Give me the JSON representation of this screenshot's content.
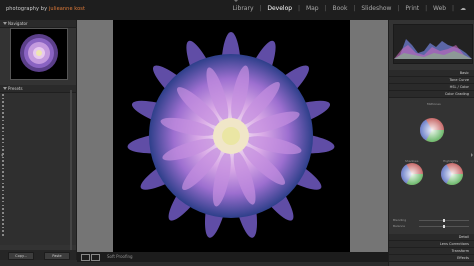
{
  "identity": {
    "prefix": "photography by ",
    "name": "julieanne kost"
  },
  "modules": [
    {
      "label": "Library",
      "active": false
    },
    {
      "label": "Develop",
      "active": true
    },
    {
      "label": "Map",
      "active": false
    },
    {
      "label": "Book",
      "active": false
    },
    {
      "label": "Slideshow",
      "active": false
    },
    {
      "label": "Print",
      "active": false
    },
    {
      "label": "Web",
      "active": false
    }
  ],
  "left_panel": {
    "navigator_title": "Navigator",
    "presets_title": "Presets",
    "copy_label": "Copy...",
    "paste_label": "Paste"
  },
  "filmstrip_toolbar": {
    "softproof_label": "Soft Proofing"
  },
  "right_panel": {
    "basic": "Basic",
    "tone_curve": "Tone Curve",
    "hsl": "HSL / Color",
    "color_grading": "Color Grading",
    "midtones": "Midtones",
    "shadows": "Shadows",
    "highlights": "Highlights",
    "blending": "Blending",
    "balance": "Balance",
    "detail": "Detail",
    "lens": "Lens Corrections",
    "transform": "Transform",
    "effects": "Effects"
  },
  "colors": {
    "accent": "#e07b39",
    "panel": "#333333",
    "background": "#757575"
  }
}
